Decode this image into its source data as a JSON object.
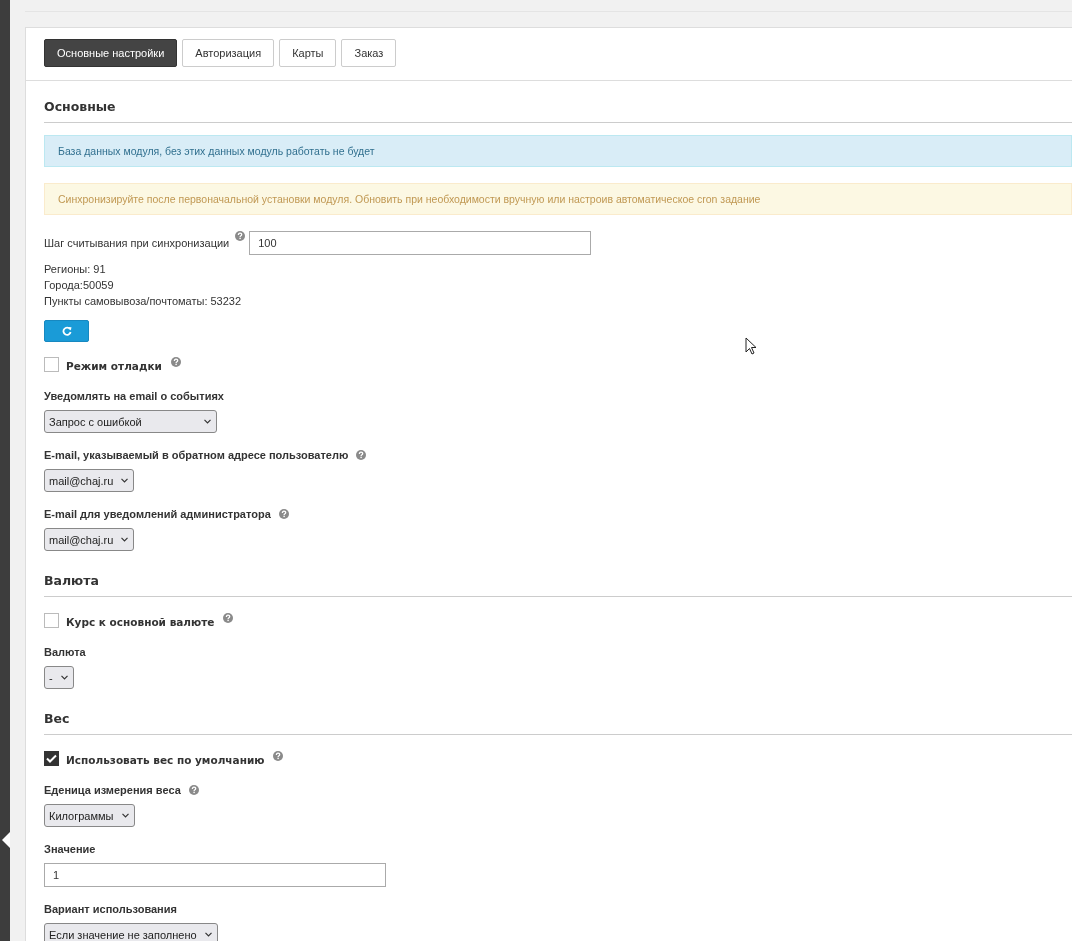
{
  "tabs": [
    {
      "label": "Основные настройки",
      "selected": true
    },
    {
      "label": "Авторизация",
      "selected": false
    },
    {
      "label": "Карты",
      "selected": false
    },
    {
      "label": "Заказ",
      "selected": false
    }
  ],
  "sections": [
    {
      "title": "Основные",
      "items": [
        {
          "kind": "info_alert",
          "text": "База данных модуля, без этих данных модуль работать не будет"
        },
        {
          "kind": "warning_alert",
          "text": "Синхронизируйте после первоначальной установки модуля. Обновить при необходимости вручную или настроив автоматическое cron задание"
        },
        {
          "kind": "inline_input",
          "label": "Шаг считывания при синхронизации",
          "help": true,
          "value": "100"
        },
        {
          "kind": "stat",
          "text": "Регионы: 91"
        },
        {
          "kind": "stat",
          "text": "Города:50059"
        },
        {
          "kind": "stat",
          "text": "Пункты самовывоза/почтоматы: 53232"
        },
        {
          "kind": "refresh_button"
        },
        {
          "kind": "checkbox",
          "label": "Режим отладки",
          "checked": false,
          "help": true
        },
        {
          "kind": "wide_select",
          "label": "Уведомлять на email о событиях",
          "help": false,
          "value": "Запрос с ошибкой"
        },
        {
          "kind": "select",
          "label": "E-mail, указываемый в обратном адресе пользователю",
          "help": true,
          "value": "mail@chaj.ru"
        },
        {
          "kind": "select",
          "label": "E-mail для уведомлений администратора",
          "help": true,
          "value": "mail@chaj.ru"
        }
      ]
    },
    {
      "title": "Валюта",
      "items": [
        {
          "kind": "checkbox",
          "label": "Курс к основной валюте",
          "checked": false,
          "help": true
        },
        {
          "kind": "select",
          "label": "Валюта",
          "help": false,
          "value": "-"
        }
      ]
    },
    {
      "title": "Вес",
      "items": [
        {
          "kind": "checkbox",
          "label": "Использовать вес по умолчанию",
          "checked": true,
          "help": true
        },
        {
          "kind": "select",
          "label": "Еденица измерения веса",
          "help": true,
          "value": "Килограммы"
        },
        {
          "kind": "text_input",
          "label": "Значение",
          "value": "1"
        },
        {
          "kind": "select",
          "label": "Вариант использования",
          "help": false,
          "value": "Если значение не заполнено"
        }
      ]
    }
  ]
}
